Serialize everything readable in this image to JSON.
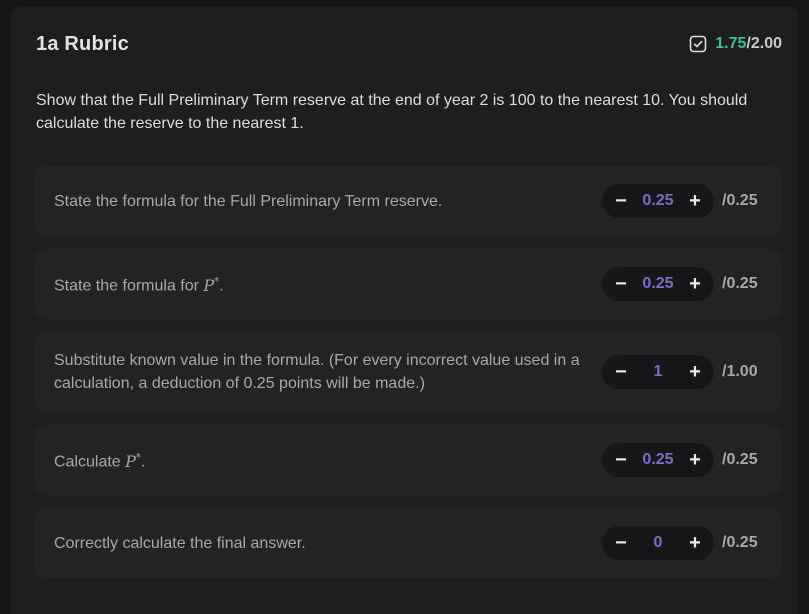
{
  "rubric": {
    "title": "1a Rubric",
    "score_icon": "checkbox-check-icon",
    "score_earned": "1.75",
    "score_total": "/2.00",
    "description": "Show that the Full Preliminary Term reserve at the end of year 2 is 100 to the nearest 10. You should calculate the reserve to the nearest 1."
  },
  "criteria": [
    {
      "text_before": "State the formula for the Full Preliminary Term reserve.",
      "math": "",
      "text_after": "",
      "value": "0.25",
      "max": "/0.25"
    },
    {
      "text_before": "State the formula for ",
      "math": "P",
      "math_sup": "*",
      "text_after": ".",
      "value": "0.25",
      "max": "/0.25"
    },
    {
      "text_before": "Substitute known value in the formula. (For every incorrect value used in a calculation, a deduction of 0.25 points will be made.)",
      "math": "",
      "text_after": "",
      "value": "1",
      "max": "/1.00"
    },
    {
      "text_before": "Calculate ",
      "math": "P",
      "math_sup": "*",
      "text_after": ".",
      "value": "0.25",
      "max": "/0.25"
    },
    {
      "text_before": "Correctly calculate the final answer.",
      "math": "",
      "text_after": "",
      "value": "0",
      "max": "/0.25"
    }
  ],
  "stepper": {
    "minus_label": "−",
    "plus_label": "+"
  },
  "colors": {
    "accent_green": "#3cc58c",
    "value_purple": "#7a6ec9"
  }
}
